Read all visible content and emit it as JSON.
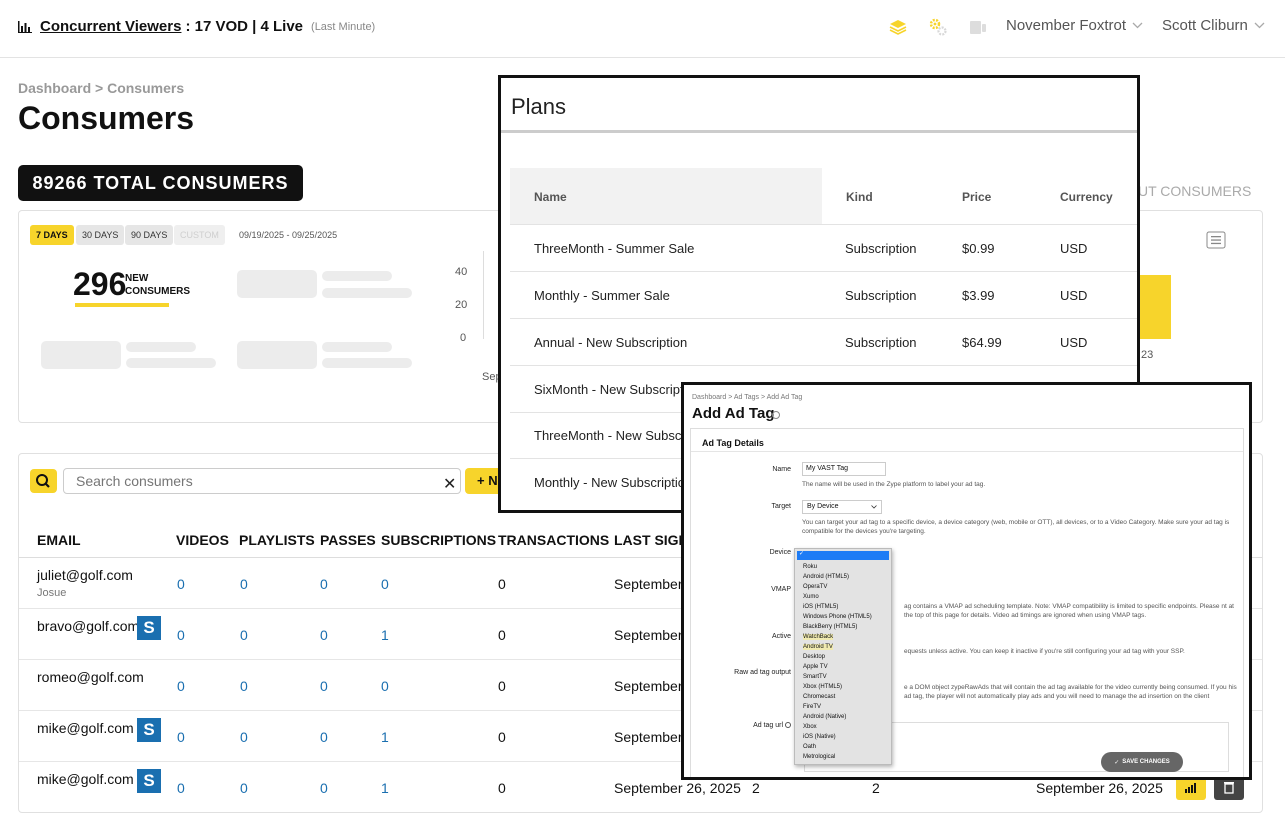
{
  "topbar": {
    "cv_label": "Concurrent Viewers",
    "cv_value": ": 17 VOD | 4 Live",
    "cv_period": "(Last Minute)",
    "org": "November Foxtrot",
    "user": "Scott Cliburn"
  },
  "page": {
    "breadcrumb_root": "Dashboard",
    "breadcrumb_sep": ">",
    "breadcrumb_current": "Consumers",
    "title": "Consumers",
    "total_badge": "89266 TOTAL CONSUMERS",
    "about_link": "UT CONSUMERS"
  },
  "stats": {
    "ranges": [
      "7 DAYS",
      "30 DAYS",
      "90 DAYS",
      "CUSTOM"
    ],
    "date_range": "09/19/2025 - 09/25/2025",
    "new_consumers": "296",
    "new_consumers_label": [
      "NEW",
      "CONSUMERS"
    ],
    "chart_ticks": [
      "40",
      "20",
      "0"
    ],
    "chart_x_label": "Sep",
    "chart_x_label_right": "23"
  },
  "chart_data": {
    "type": "bar",
    "ylim": [
      0,
      40
    ],
    "yticks": [
      40,
      20,
      0
    ],
    "categories": [
      "Sep",
      "23"
    ],
    "series": [
      {
        "values": [
          null,
          35
        ]
      }
    ],
    "colors": {
      "bar": "#f7d42b"
    }
  },
  "table": {
    "search_placeholder": "Search consumers",
    "add_button_text": "+ N",
    "columns": [
      "EMAIL",
      "VIDEOS",
      "PLAYLISTS",
      "PASSES",
      "SUBSCRIPTIONS",
      "TRANSACTIONS",
      "LAST SIGN"
    ],
    "rows": [
      {
        "email": "juliet@golf.com",
        "name": "Josue",
        "stripe": false,
        "videos": "0",
        "playlists": "0",
        "passes": "0",
        "subscriptions": "0",
        "transactions": "0",
        "last_sign": "September"
      },
      {
        "email": "bravo@golf.com",
        "name": "",
        "stripe": true,
        "videos": "0",
        "playlists": "0",
        "passes": "0",
        "subscriptions": "1",
        "transactions": "0",
        "last_sign": "September"
      },
      {
        "email": "romeo@golf.com",
        "name": "",
        "stripe": false,
        "videos": "0",
        "playlists": "0",
        "passes": "0",
        "subscriptions": "0",
        "transactions": "0",
        "last_sign": "September"
      },
      {
        "email": "mike@golf.com",
        "name": "",
        "stripe": true,
        "videos": "0",
        "playlists": "0",
        "passes": "0",
        "subscriptions": "1",
        "transactions": "0",
        "last_sign": "September"
      },
      {
        "email": "mike@golf.com",
        "name": "",
        "stripe": true,
        "videos": "0",
        "playlists": "0",
        "passes": "0",
        "subscriptions": "1",
        "transactions": "0",
        "last_sign": "September 26, 2025",
        "extra1": "2",
        "extra2": "2",
        "extra_date": "September 26, 2025"
      }
    ],
    "stripe_letter": "S"
  },
  "plans": {
    "title": "Plans",
    "columns": [
      "Name",
      "Kind",
      "Price",
      "Currency"
    ],
    "rows": [
      {
        "name": "ThreeMonth - Summer Sale",
        "kind": "Subscription",
        "price": "$0.99",
        "currency": "USD"
      },
      {
        "name": "Monthly - Summer Sale",
        "kind": "Subscription",
        "price": "$3.99",
        "currency": "USD"
      },
      {
        "name": "Annual - New Subscription",
        "kind": "Subscription",
        "price": "$64.99",
        "currency": "USD"
      },
      {
        "name": "SixMonth - New Subscripti",
        "kind": "",
        "price": "",
        "currency": ""
      },
      {
        "name": "ThreeMonth - New Subscr",
        "kind": "",
        "price": "",
        "currency": ""
      },
      {
        "name": "Monthly - New Subscriptio",
        "kind": "",
        "price": "",
        "currency": ""
      }
    ]
  },
  "adtag": {
    "breadcrumb": "Dashboard > Ad Tags > Add Ad Tag",
    "title": "Add Ad Tag",
    "section": "Ad Tag Details",
    "name_label": "Name",
    "name_value": "My VAST Tag",
    "name_help": "The name will be used in the Zype platform to label your ad tag.",
    "target_label": "Target",
    "target_value": "By Device",
    "target_help": "You can target your ad tag to a specific device, a device category (web, mobile or OTT), all devices, or to a Video Category. Make sure your ad tag is compatible for the devices you're targeting.",
    "device_label": "Device",
    "vmap_label": "VMAP",
    "vmap_help": "ag contains a VMAP ad scheduling template. Note: VMAP compatibility is limited to specific endpoints. Please nt at the top of this page for details. Video ad timings are ignored when using VMAP tags.",
    "active_label": "Active",
    "active_help": "equests unless active. You can keep it inactive if you're still configuring your ad tag with your SSP.",
    "raw_label": "Raw ad tag output",
    "raw_help": "e a DOM object zypeRawAds that will contain the ad tag available for the video currently being consumed. If you his ad tag, the player will not automatically play ads and you will need to manage the ad insertion on the client",
    "url_label": "Ad tag url",
    "save_label": "SAVE CHANGES",
    "device_options": [
      "Roku",
      "Android (HTML5)",
      "OperaTV",
      "Xumo",
      "iOS (HTML5)",
      "Windows Phone (HTML5)",
      "BlackBerry (HTML5)",
      "WatchBack",
      "Android TV",
      "Desktop",
      "Apple TV",
      "SmartTV",
      "Xbox (HTML5)",
      "Chromecast",
      "FireTV",
      "Android (Native)",
      "Xbox",
      "iOS (Native)",
      "Oath",
      "Metrological"
    ]
  }
}
